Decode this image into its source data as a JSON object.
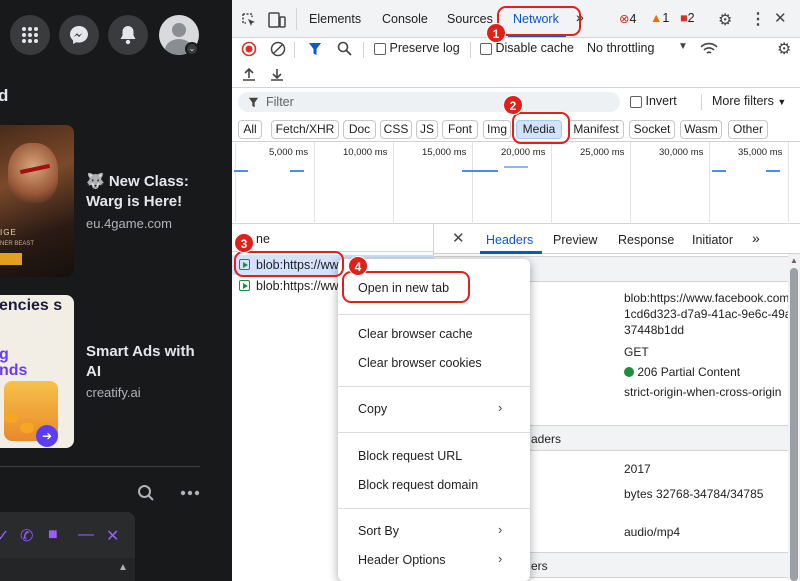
{
  "facebook": {
    "heading_fragment": "d",
    "ads": [
      {
        "title": "🐺 New Class: Warg is Here!",
        "domain": "eu.4game.com",
        "img_caption": "IGE",
        "img_sub": "NER BEAST"
      },
      {
        "title": "Smart Ads with AI",
        "domain": "creatify.ai",
        "img_text_1": "encies s",
        "img_text_2": "g nds"
      }
    ]
  },
  "devtools": {
    "tabs": [
      "Elements",
      "Console",
      "Sources",
      "Network"
    ],
    "active_tab": "Network",
    "more_tabs_icon": "»",
    "badges": {
      "errors": "4",
      "warnings": "1",
      "info": "2"
    },
    "toolbar2": {
      "preserve_log": "Preserve log",
      "disable_cache": "Disable cache",
      "throttling": "No throttling"
    },
    "filter": {
      "placeholder": "Filter",
      "invert": "Invert",
      "more_filters": "More filters"
    },
    "type_filters": [
      "All",
      "Fetch/XHR",
      "Doc",
      "CSS",
      "JS",
      "Font",
      "Img",
      "Media",
      "Manifest",
      "Socket",
      "Wasm",
      "Other"
    ],
    "active_type": "Media",
    "timeline_ticks": [
      "5,000 ms",
      "10,000 ms",
      "15,000 ms",
      "20,000 ms",
      "25,000 ms",
      "30,000 ms",
      "35,000 ms"
    ],
    "name_column_header": "ne",
    "requests": [
      "blob:https://ww",
      "blob:https://ww"
    ],
    "detail_tabs": [
      "Headers",
      "Preview",
      "Response",
      "Initiator"
    ],
    "active_detail_tab": "Headers",
    "detail_more": "»",
    "general": {
      "url": "blob:https://www.facebook.com/1cd6d323-d7a9-41ac-9e6c-49a37448b1dd",
      "method": "GET",
      "status": "206 Partial Content",
      "referrer_policy": "strict-origin-when-cross-origin"
    },
    "section_response_headers": "aders",
    "response_headers": {
      "v1": "2017",
      "content_range": "bytes 32768-34784/34785",
      "content_type": "audio/mp4"
    },
    "section_request_headers": "ers",
    "context_menu": {
      "items": [
        "Open in new tab",
        "Clear browser cache",
        "Clear browser cookies",
        "Copy",
        "Block request URL",
        "Block request domain",
        "Sort By",
        "Header Options"
      ],
      "submenu_arrow": "›"
    },
    "annotations": [
      "1",
      "2",
      "3",
      "4"
    ]
  },
  "colors": {
    "accent": "#0b57d0",
    "annotation": "#e0201b",
    "fb_bg": "#18191a"
  }
}
